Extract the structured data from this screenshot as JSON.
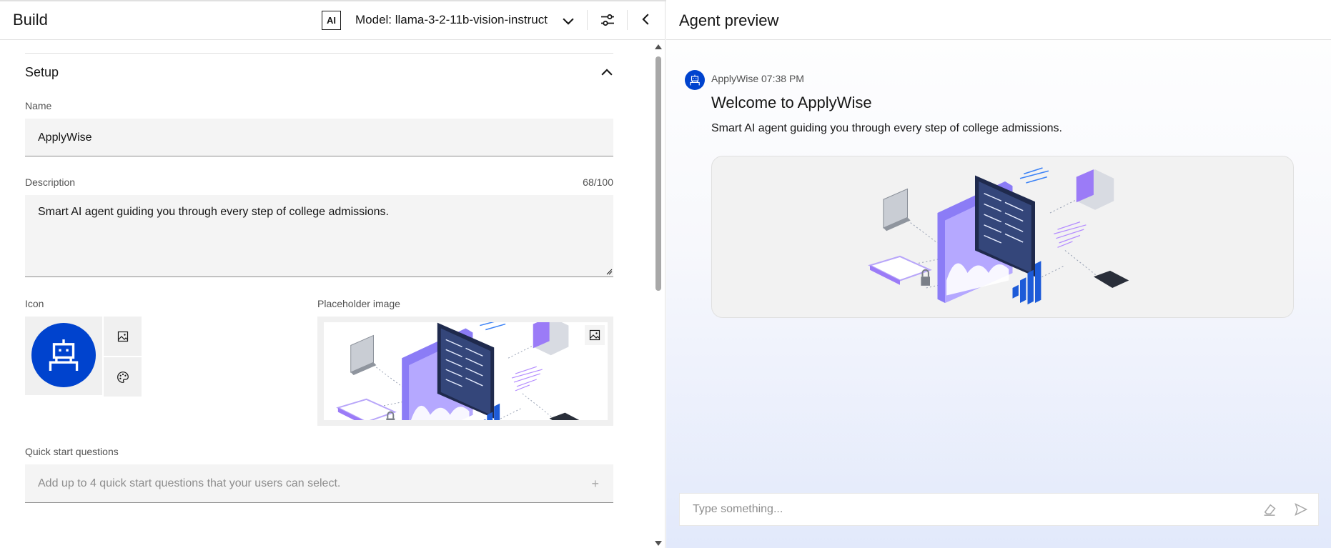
{
  "build": {
    "title": "Build",
    "ai_badge": "AI",
    "model_label": "Model: llama-3-2-11b-vision-instruct"
  },
  "setup": {
    "title": "Setup",
    "name_label": "Name",
    "name_value": "ApplyWise",
    "description_label": "Description",
    "description_value": "Smart AI agent guiding you through every step of college admissions.",
    "description_counter": "68/100",
    "icon_label": "Icon",
    "placeholder_label": "Placeholder image",
    "quick_start_label": "Quick start questions",
    "quick_start_placeholder": "Add up to 4 quick start questions that your users can select.",
    "quick_start_plus": "+"
  },
  "preview": {
    "title": "Agent preview",
    "message_meta": "ApplyWise 07:38 PM",
    "message_title": "Welcome to ApplyWise",
    "message_desc": "Smart AI agent guiding you through every step of college admissions.",
    "input_placeholder": "Type something..."
  },
  "icons": [
    "ai-icon",
    "chevron-down-icon",
    "settings-sliders-icon",
    "chevron-left-icon",
    "chevron-up-icon",
    "robot-icon",
    "image-icon",
    "palette-icon",
    "plus-icon",
    "eraser-icon",
    "send-icon"
  ],
  "colors": {
    "accent": "#0043ce",
    "field_bg": "#f4f4f4",
    "border": "#e0e0e0",
    "illustration_purple": "#a78bfa",
    "illustration_navy": "#2b3a67"
  }
}
